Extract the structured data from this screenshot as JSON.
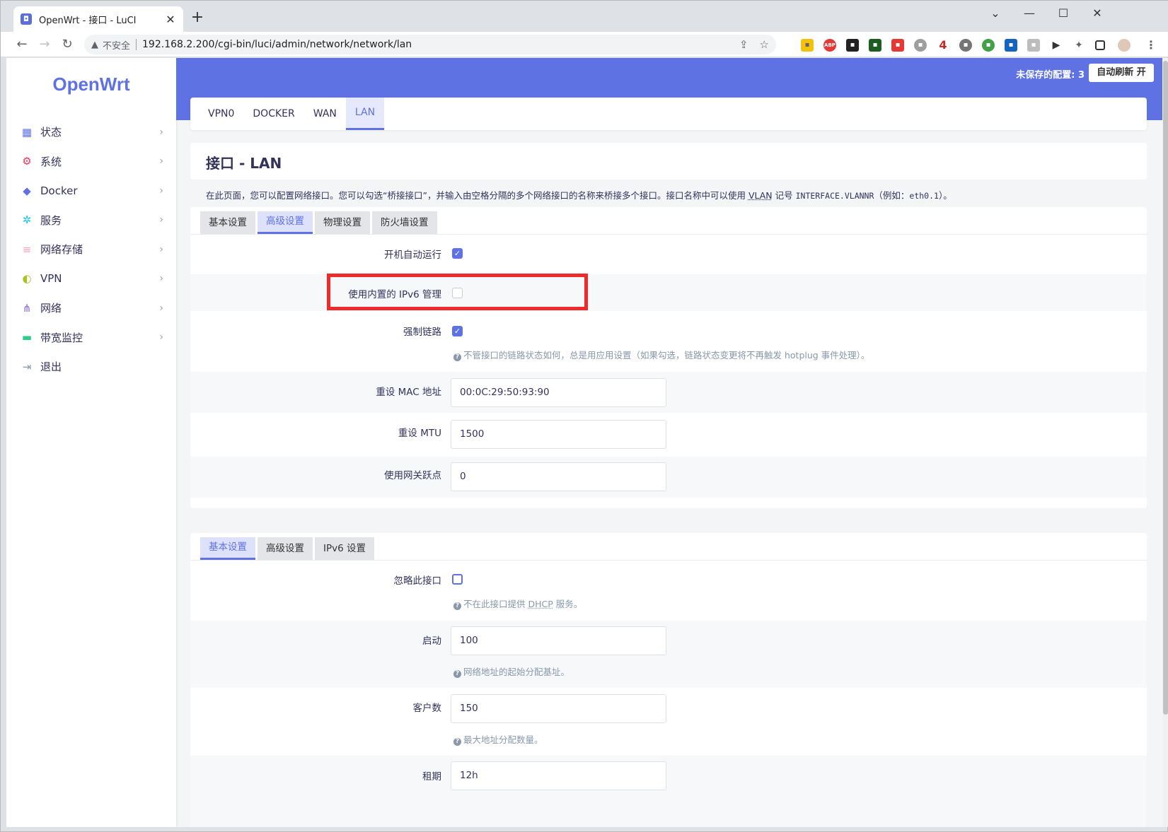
{
  "browser": {
    "tab_title": "OpenWrt - 接口 - LuCI",
    "tab_close": "✕",
    "new_tab": "+",
    "security_warning": "不安全",
    "url": "192.168.2.200/cgi-bin/luci/admin/network/network/lan",
    "ext_abp": "ABP",
    "ext_four": "4"
  },
  "sidebar": {
    "logo": "OpenWrt",
    "items": [
      {
        "label": "状态",
        "icon": "dashboard-icon",
        "color": "#5e72e4"
      },
      {
        "label": "系统",
        "icon": "gear-icon",
        "color": "#f5365c"
      },
      {
        "label": "Docker",
        "icon": "docker-icon",
        "color": "#5e72e4"
      },
      {
        "label": "服务",
        "icon": "services-icon",
        "color": "#11cdef"
      },
      {
        "label": "网络存储",
        "icon": "database-icon",
        "color": "#f3a4b5"
      },
      {
        "label": "VPN",
        "icon": "vpn-icon",
        "color": "#aec124"
      },
      {
        "label": "网络",
        "icon": "network-icon",
        "color": "#8965e0"
      },
      {
        "label": "带宽监控",
        "icon": "monitor-icon",
        "color": "#2dce89"
      },
      {
        "label": "退出",
        "icon": "logout-icon",
        "color": "#8898aa"
      }
    ]
  },
  "header": {
    "unsaved": "未保存的配置: 3",
    "autorefresh": "自动刷新 开",
    "accent": "#5e72e4"
  },
  "iface_tabs": [
    "VPN0",
    "DOCKER",
    "WAN",
    "LAN"
  ],
  "page": {
    "title": "接口 - LAN",
    "desc_a": "在此页面，您可以配置网络接口。您可以勾选“桥接接口”，并输入由空格分隔的多个网络接口的名称来桥接多个接口。接口名称中可以使用 ",
    "desc_vlan": "VLAN",
    "desc_b": " 记号 ",
    "desc_mono1": "INTERFACE.VLANNR",
    "desc_c": "（例如：",
    "desc_mono2": "eth0.1",
    "desc_d": "）。"
  },
  "general": {
    "tabs": [
      "基本设置",
      "高级设置",
      "物理设置",
      "防火墙设置"
    ],
    "fields": {
      "autostart_label": "开机自动运行",
      "ipv6_label": "使用内置的 IPv6 管理",
      "force_link_label": "强制链路",
      "force_link_help": "不管接口的链路状态如何，总是用应用设置（如果勾选，链路状态变更将不再触发 hotplug 事件处理）。",
      "mac_label": "重设 MAC 地址",
      "mac_value": "00:0C:29:50:93:90",
      "mtu_label": "重设 MTU",
      "mtu_value": "1500",
      "metric_label": "使用网关跃点",
      "metric_value": "0"
    }
  },
  "dhcp": {
    "tabs": [
      "基本设置",
      "高级设置",
      "IPv6 设置"
    ],
    "fields": {
      "ignore_label": "忽略此接口",
      "ignore_help_a": "不在此接口提供 ",
      "ignore_help_dhcp": "DHCP",
      "ignore_help_b": " 服务。",
      "start_label": "启动",
      "start_value": "100",
      "start_help": "网络地址的起始分配基址。",
      "limit_label": "客户数",
      "limit_value": "150",
      "limit_help": "最大地址分配数量。",
      "lease_label": "租期",
      "lease_value": "12h"
    }
  }
}
